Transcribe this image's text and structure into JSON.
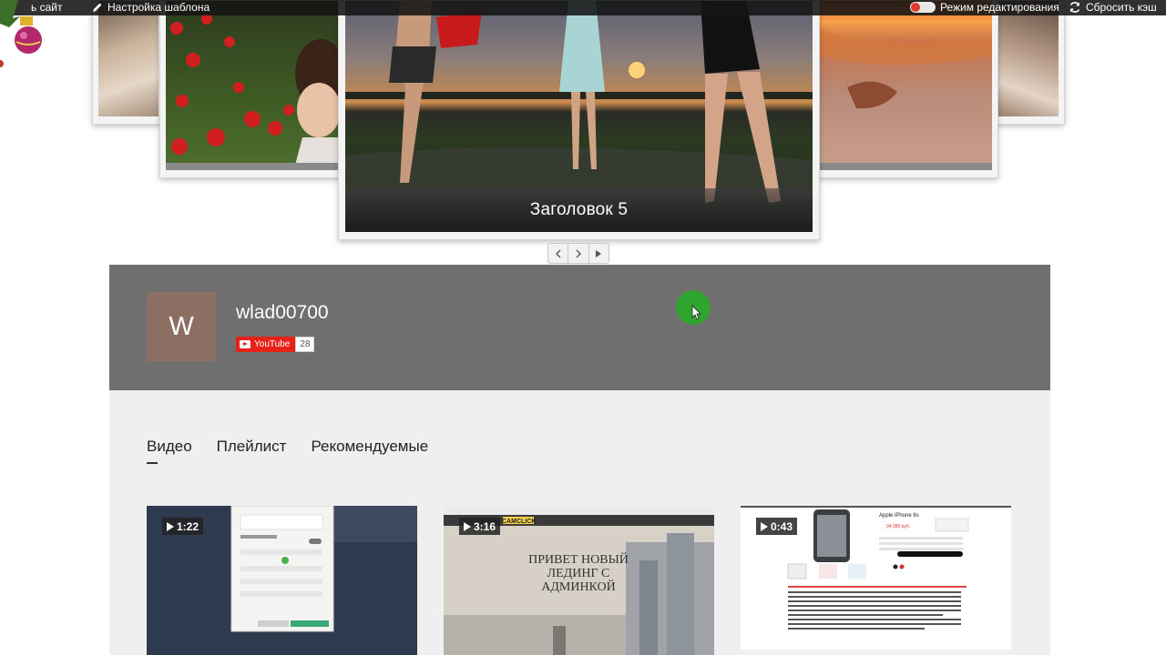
{
  "adminbar": {
    "view_site": "ь сайт",
    "template_settings": "Настройка шаблона",
    "edit_mode": "Режим редактирования",
    "reset_cache": "Сбросить кэш"
  },
  "slider": {
    "caption": "Заголовок 5"
  },
  "channel": {
    "avatar_letter": "W",
    "name": "wlad00700",
    "youtube_label": "YouTube",
    "subscriber_count": "28"
  },
  "tabs": [
    "Видео",
    "Плейлист",
    "Рекомендуемые"
  ],
  "videos": [
    {
      "duration": "1:22"
    },
    {
      "duration": "3:16"
    },
    {
      "duration": "0:43"
    }
  ],
  "thumb_text": {
    "camclick": "CAMCLICK",
    "landing_line1": "ПРИВЕТ НОВЫЙ",
    "landing_line2": "ЛЕДИНГ С",
    "landing_line3": "АДМИНКОЙ",
    "phone_title": "Apple iPhone 6s",
    "phone_price": "34 990 руб."
  },
  "colors": {
    "channel_bg": "#6f6f6f",
    "avatar_bg": "#8d6e63",
    "youtube_red": "#e62117",
    "content_bg": "#efefef",
    "cursor_dot": "#2fa52f"
  }
}
